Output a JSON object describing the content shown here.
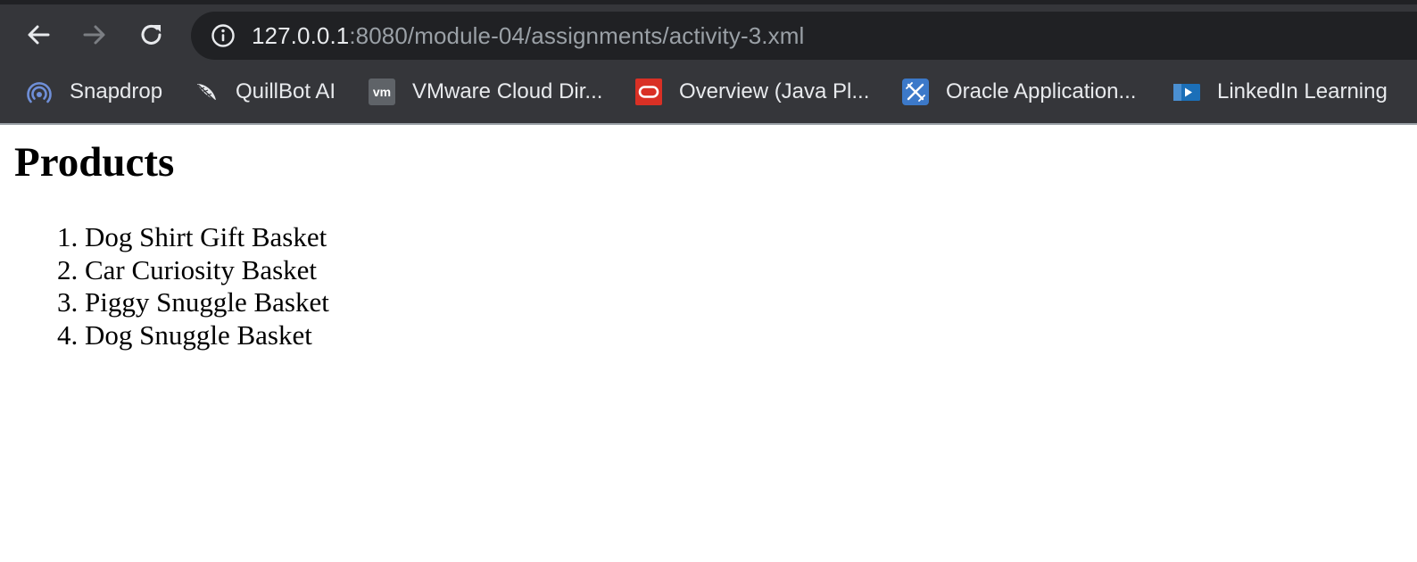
{
  "browser": {
    "url_host": "127.0.0.1",
    "url_path": ":8080/module-04/assignments/activity-3.xml",
    "nav": {
      "back_icon": "arrow-left-icon",
      "forward_icon": "arrow-right-icon",
      "reload_icon": "reload-icon",
      "site_info_icon": "info-circle-icon"
    },
    "bookmarks": [
      {
        "label": "Snapdrop",
        "icon": "snapdrop-icon",
        "color": "#6f8fd8"
      },
      {
        "label": "QuillBot AI",
        "icon": "quill-feather-icon",
        "color": "#e8eaed"
      },
      {
        "label": "VMware Cloud Dir...",
        "icon": "vmware-icon",
        "color": "#5f6368"
      },
      {
        "label": "Overview (Java Pl...",
        "icon": "oracle-icon",
        "color": "#d93025"
      },
      {
        "label": "Oracle Application...",
        "icon": "oracle-apex-icon",
        "color": "#3c79c9"
      },
      {
        "label": "LinkedIn Learning",
        "icon": "linkedin-learning-icon",
        "color": "#1b6fb8"
      }
    ]
  },
  "page": {
    "heading": "Products",
    "products": [
      "Dog Shirt Gift Basket",
      "Car Curiosity Basket",
      "Piggy Snuggle Basket",
      "Dog Snuggle Basket"
    ]
  }
}
